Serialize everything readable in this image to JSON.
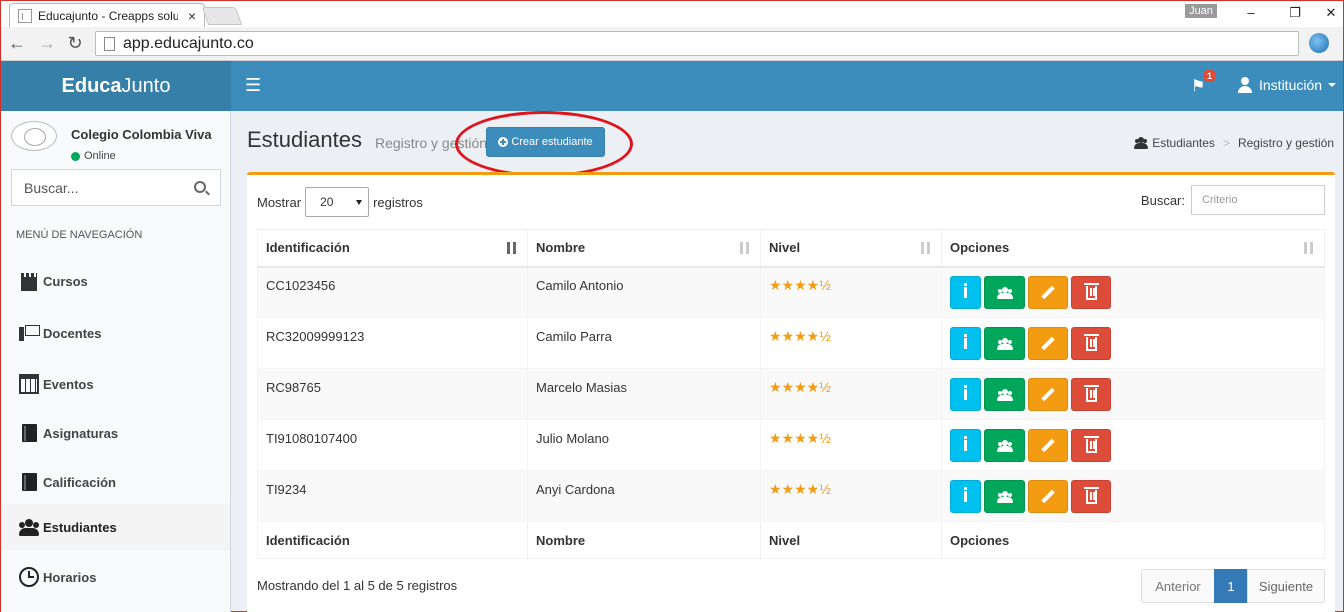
{
  "browser": {
    "tab_title": "Educajunto - Creapps solu",
    "tab_close": "×",
    "user_chip": "Juan",
    "url": "app.educajunto.co",
    "min": "–",
    "restore": "❐",
    "close": "✕",
    "back": "←",
    "forward": "→",
    "reload": "↻"
  },
  "header": {
    "logo_bold": "Educa",
    "logo_light": "Junto",
    "menu_icon": "☰",
    "flag_icon": "⚑",
    "notifications_count": "1",
    "user_label": "Institución"
  },
  "sidebar": {
    "school_name": "Colegio Colombia Viva",
    "status": "Online",
    "search_placeholder": "Buscar...",
    "nav_header": "MENÚ DE NAVEGACIÓN",
    "items": [
      {
        "label": "Cursos",
        "icon": "castle-icon"
      },
      {
        "label": "Docentes",
        "icon": "teacher-icon"
      },
      {
        "label": "Eventos",
        "icon": "calendar-icon"
      },
      {
        "label": "Asignaturas",
        "icon": "book-icon"
      },
      {
        "label": "Calificación",
        "icon": "book-icon"
      },
      {
        "label": "Estudiantes",
        "icon": "users-icon"
      },
      {
        "label": "Horarios",
        "icon": "clock-icon"
      }
    ]
  },
  "page": {
    "title": "Estudiantes",
    "subtitle": "Registro y gestión",
    "create_button": "Crear estudiante",
    "breadcrumb": {
      "root": "Estudiantes",
      "sep": ">",
      "current": "Registro y gestión"
    }
  },
  "table": {
    "show_prefix": "Mostrar",
    "page_length": "20",
    "show_suffix": "registros",
    "search_label": "Buscar:",
    "search_placeholder": "Criterio",
    "columns": [
      "Identificación",
      "Nombre",
      "Nivel",
      "Opciones"
    ],
    "rows": [
      {
        "id": "CC1023456",
        "name": "Camilo Antonio",
        "level": "★★★★½"
      },
      {
        "id": "RC32009999123",
        "name": "Camilo Parra",
        "level": "★★★★½"
      },
      {
        "id": "RC98765",
        "name": "Marcelo Masias",
        "level": "★★★★½"
      },
      {
        "id": "TI91080107400",
        "name": "Julio Molano",
        "level": "★★★★½"
      },
      {
        "id": "TI9234",
        "name": "Anyi Cardona",
        "level": "★★★★½"
      }
    ],
    "info": "Mostrando del 1 al 5 de 5 registros",
    "prev": "Anterior",
    "current_page": "1",
    "next": "Siguiente"
  },
  "colors": {
    "header": "#3c8dbc",
    "accent": "#f39c12",
    "danger": "#dd4b39",
    "success": "#00a65a",
    "info": "#00c0ef"
  }
}
